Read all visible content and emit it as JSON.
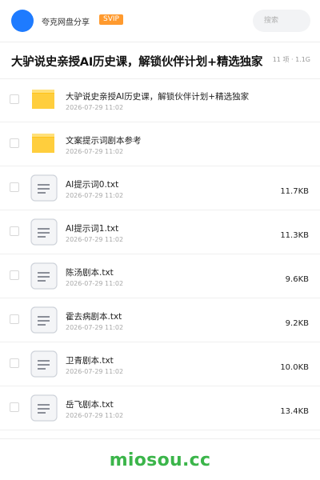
{
  "header": {
    "user_name": "夸克网盘分享",
    "vip_badge": "SVIP",
    "search_placeholder": "搜索"
  },
  "share": {
    "title": "大驴说史亲授AI历史课，解锁伙伴计划+精选独家",
    "meta": "11 项 · 1.1G"
  },
  "files": [
    {
      "type": "folder",
      "name": "大驴说史亲授AI历史课，解锁伙伴计划+精选独家",
      "date": "2026-07-29 11:02",
      "size": ""
    },
    {
      "type": "folder",
      "name": "文案提示词剧本参考",
      "date": "2026-07-29 11:02",
      "size": ""
    },
    {
      "type": "txt",
      "name": "AI提示词0.txt",
      "date": "2026-07-29 11:02",
      "size": "11.7KB"
    },
    {
      "type": "txt",
      "name": "AI提示词1.txt",
      "date": "2026-07-29 11:02",
      "size": "11.3KB"
    },
    {
      "type": "txt",
      "name": "陈汤剧本.txt",
      "date": "2026-07-29 11:02",
      "size": "9.6KB"
    },
    {
      "type": "txt",
      "name": "霍去病剧本.txt",
      "date": "2026-07-29 11:02",
      "size": "9.2KB"
    },
    {
      "type": "txt",
      "name": "卫青剧本.txt",
      "date": "2026-07-29 11:02",
      "size": "10.0KB"
    },
    {
      "type": "txt",
      "name": "岳飞剧本.txt",
      "date": "2026-07-29 11:02",
      "size": "13.4KB"
    }
  ],
  "footer": {
    "watermark": "miosou.cc"
  },
  "colors": {
    "avatar": "#1e7bff",
    "vip": "#ff9a2e",
    "folder": "#ffc21a",
    "watermark": "#3bb54a"
  },
  "icons": {
    "folder": "folder-icon",
    "txt": "text-file-icon"
  }
}
